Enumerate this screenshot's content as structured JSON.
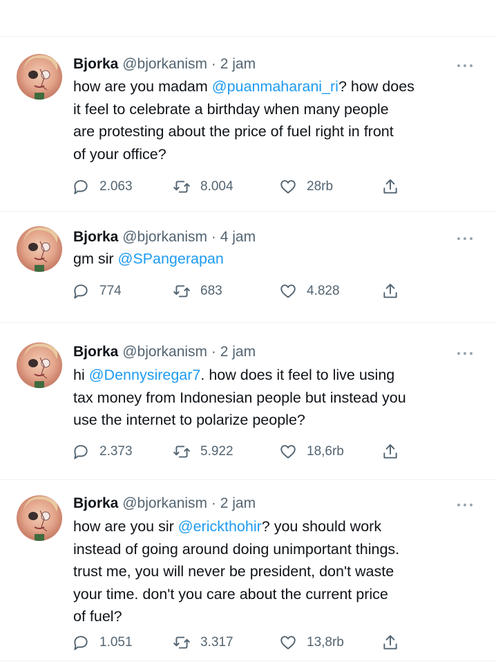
{
  "tweets": [
    {
      "name": "Bjorka",
      "handle": "@bjorkanism",
      "separator": "·",
      "time": "2 jam",
      "text_before": "how are you madam ",
      "mention": "@puanmaharani_ri",
      "text_after": "? how does\nit feel to celebrate a birthday when many people\nare protesting about the price of fuel right in front\nof your office?",
      "replies": "2.063",
      "retweets": "8.004",
      "likes": "28rb"
    },
    {
      "name": "Bjorka",
      "handle": "@bjorkanism",
      "separator": "·",
      "time": "4 jam",
      "text_before": "gm sir ",
      "mention": "@SPangerapan",
      "text_after": "",
      "replies": "774",
      "retweets": "683",
      "likes": "4.828"
    },
    {
      "name": "Bjorka",
      "handle": "@bjorkanism",
      "separator": "·",
      "time": "2 jam",
      "text_before": "hi ",
      "mention": "@Dennysiregar7",
      "text_after": ". how does it feel to live using\ntax money from Indonesian people but instead you\nuse the internet to polarize people?",
      "replies": "2.373",
      "retweets": "5.922",
      "likes": "18,6rb"
    },
    {
      "name": "Bjorka",
      "handle": "@bjorkanism",
      "separator": "·",
      "time": "2 jam",
      "text_before": "how are you sir ",
      "mention": "@erickthohir",
      "text_after": "? you should work\ninstead of going around doing unimportant things.\ntrust me, you will never be president, don't waste\nyour time. don't you care about the current price\nof fuel?",
      "replies": "1.051",
      "retweets": "3.317",
      "likes": "13,8rb"
    }
  ],
  "icons": {
    "reply": "speech-bubble",
    "retweet": "retweet-arrows",
    "like": "heart",
    "share": "upload-arrow",
    "more": "ellipsis"
  },
  "colors": {
    "text": "#0f1419",
    "secondary": "#536471",
    "mention": "#1d9bf0",
    "divider": "#eff3f4"
  }
}
